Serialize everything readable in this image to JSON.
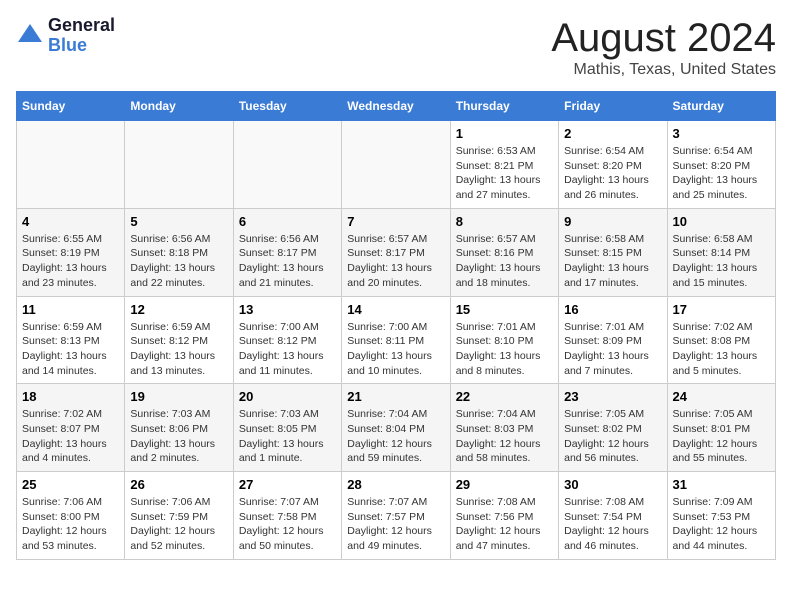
{
  "header": {
    "logo_line1": "General",
    "logo_line2": "Blue",
    "main_title": "August 2024",
    "subtitle": "Mathis, Texas, United States"
  },
  "calendar": {
    "headers": [
      "Sunday",
      "Monday",
      "Tuesday",
      "Wednesday",
      "Thursday",
      "Friday",
      "Saturday"
    ],
    "weeks": [
      [
        {
          "day": "",
          "info": ""
        },
        {
          "day": "",
          "info": ""
        },
        {
          "day": "",
          "info": ""
        },
        {
          "day": "",
          "info": ""
        },
        {
          "day": "1",
          "info": "Sunrise: 6:53 AM\nSunset: 8:21 PM\nDaylight: 13 hours\nand 27 minutes."
        },
        {
          "day": "2",
          "info": "Sunrise: 6:54 AM\nSunset: 8:20 PM\nDaylight: 13 hours\nand 26 minutes."
        },
        {
          "day": "3",
          "info": "Sunrise: 6:54 AM\nSunset: 8:20 PM\nDaylight: 13 hours\nand 25 minutes."
        }
      ],
      [
        {
          "day": "4",
          "info": "Sunrise: 6:55 AM\nSunset: 8:19 PM\nDaylight: 13 hours\nand 23 minutes."
        },
        {
          "day": "5",
          "info": "Sunrise: 6:56 AM\nSunset: 8:18 PM\nDaylight: 13 hours\nand 22 minutes."
        },
        {
          "day": "6",
          "info": "Sunrise: 6:56 AM\nSunset: 8:17 PM\nDaylight: 13 hours\nand 21 minutes."
        },
        {
          "day": "7",
          "info": "Sunrise: 6:57 AM\nSunset: 8:17 PM\nDaylight: 13 hours\nand 20 minutes."
        },
        {
          "day": "8",
          "info": "Sunrise: 6:57 AM\nSunset: 8:16 PM\nDaylight: 13 hours\nand 18 minutes."
        },
        {
          "day": "9",
          "info": "Sunrise: 6:58 AM\nSunset: 8:15 PM\nDaylight: 13 hours\nand 17 minutes."
        },
        {
          "day": "10",
          "info": "Sunrise: 6:58 AM\nSunset: 8:14 PM\nDaylight: 13 hours\nand 15 minutes."
        }
      ],
      [
        {
          "day": "11",
          "info": "Sunrise: 6:59 AM\nSunset: 8:13 PM\nDaylight: 13 hours\nand 14 minutes."
        },
        {
          "day": "12",
          "info": "Sunrise: 6:59 AM\nSunset: 8:12 PM\nDaylight: 13 hours\nand 13 minutes."
        },
        {
          "day": "13",
          "info": "Sunrise: 7:00 AM\nSunset: 8:12 PM\nDaylight: 13 hours\nand 11 minutes."
        },
        {
          "day": "14",
          "info": "Sunrise: 7:00 AM\nSunset: 8:11 PM\nDaylight: 13 hours\nand 10 minutes."
        },
        {
          "day": "15",
          "info": "Sunrise: 7:01 AM\nSunset: 8:10 PM\nDaylight: 13 hours\nand 8 minutes."
        },
        {
          "day": "16",
          "info": "Sunrise: 7:01 AM\nSunset: 8:09 PM\nDaylight: 13 hours\nand 7 minutes."
        },
        {
          "day": "17",
          "info": "Sunrise: 7:02 AM\nSunset: 8:08 PM\nDaylight: 13 hours\nand 5 minutes."
        }
      ],
      [
        {
          "day": "18",
          "info": "Sunrise: 7:02 AM\nSunset: 8:07 PM\nDaylight: 13 hours\nand 4 minutes."
        },
        {
          "day": "19",
          "info": "Sunrise: 7:03 AM\nSunset: 8:06 PM\nDaylight: 13 hours\nand 2 minutes."
        },
        {
          "day": "20",
          "info": "Sunrise: 7:03 AM\nSunset: 8:05 PM\nDaylight: 13 hours\nand 1 minute."
        },
        {
          "day": "21",
          "info": "Sunrise: 7:04 AM\nSunset: 8:04 PM\nDaylight: 12 hours\nand 59 minutes."
        },
        {
          "day": "22",
          "info": "Sunrise: 7:04 AM\nSunset: 8:03 PM\nDaylight: 12 hours\nand 58 minutes."
        },
        {
          "day": "23",
          "info": "Sunrise: 7:05 AM\nSunset: 8:02 PM\nDaylight: 12 hours\nand 56 minutes."
        },
        {
          "day": "24",
          "info": "Sunrise: 7:05 AM\nSunset: 8:01 PM\nDaylight: 12 hours\nand 55 minutes."
        }
      ],
      [
        {
          "day": "25",
          "info": "Sunrise: 7:06 AM\nSunset: 8:00 PM\nDaylight: 12 hours\nand 53 minutes."
        },
        {
          "day": "26",
          "info": "Sunrise: 7:06 AM\nSunset: 7:59 PM\nDaylight: 12 hours\nand 52 minutes."
        },
        {
          "day": "27",
          "info": "Sunrise: 7:07 AM\nSunset: 7:58 PM\nDaylight: 12 hours\nand 50 minutes."
        },
        {
          "day": "28",
          "info": "Sunrise: 7:07 AM\nSunset: 7:57 PM\nDaylight: 12 hours\nand 49 minutes."
        },
        {
          "day": "29",
          "info": "Sunrise: 7:08 AM\nSunset: 7:56 PM\nDaylight: 12 hours\nand 47 minutes."
        },
        {
          "day": "30",
          "info": "Sunrise: 7:08 AM\nSunset: 7:54 PM\nDaylight: 12 hours\nand 46 minutes."
        },
        {
          "day": "31",
          "info": "Sunrise: 7:09 AM\nSunset: 7:53 PM\nDaylight: 12 hours\nand 44 minutes."
        }
      ]
    ]
  }
}
